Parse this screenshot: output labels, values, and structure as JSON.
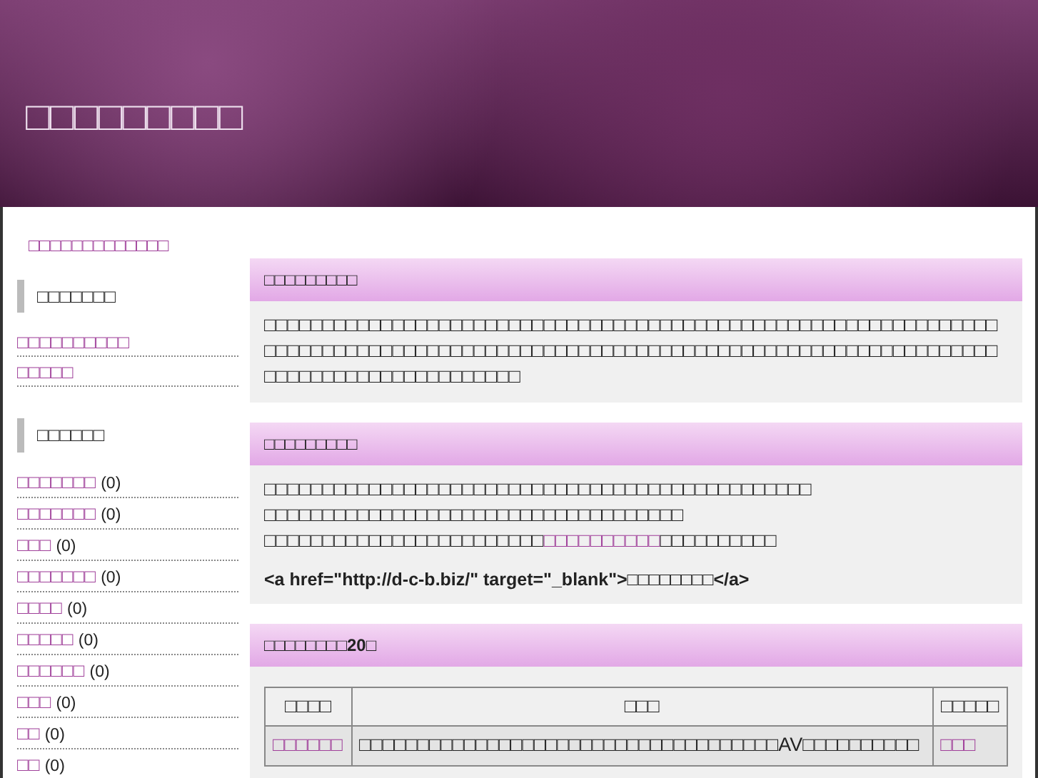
{
  "header": {
    "title": "□□□□□□□□□"
  },
  "breadcrumb": {
    "link": "□□□□□□□□□□□□□"
  },
  "sidebar": [
    {
      "heading": "□□□□□□□",
      "items": [
        {
          "label": "□□□□□□□□□□"
        },
        {
          "label": "□□□□□"
        }
      ]
    },
    {
      "heading": "□□□□□□",
      "items": [
        {
          "label": "□□□□□□□",
          "count": "(0)"
        },
        {
          "label": "□□□□□□□",
          "count": "(0)"
        },
        {
          "label": "□□□",
          "count": "(0)"
        },
        {
          "label": "□□□□□□□",
          "count": "(0)"
        },
        {
          "label": "□□□□",
          "count": "(0)"
        },
        {
          "label": "□□□□□",
          "count": "(0)"
        },
        {
          "label": "□□□□□□",
          "count": "(0)"
        },
        {
          "label": "□□□",
          "count": "(0)"
        },
        {
          "label": "□□",
          "count": "(0)"
        },
        {
          "label": "□□",
          "count": "(0)"
        }
      ]
    }
  ],
  "boxes": [
    {
      "kind": "text",
      "heading": "□□□□□□□□□",
      "paragraphs": [
        [
          {
            "kind": "text",
            "text": "□□□□□□□□□□□□□□□□□□□□□□□□□□□□□□□□□□□□□□□□□□□□□□□□□□□□□□□□□□□□□□□□□□□□□□□□□□□□□□□□□□□□□□□□□□□□□□□□□□□□□□□□□□□□□□□□□□□□□□□□□□□□□□□□□□□□□□□□□□□□□□□□□□□□"
          }
        ]
      ]
    },
    {
      "kind": "text",
      "heading": "□□□□□□□□□",
      "paragraphs": [
        [
          {
            "kind": "text",
            "text": "□□□□□□□□□□□□□□□□□□□□□□□□□□□□□□□□□□□□□□□□□□□□□□□"
          }
        ],
        [
          {
            "kind": "text",
            "text": "□□□□□□□□□□□□□□□□□□□□□□□□□□□□□□□□□□□□"
          }
        ],
        [
          {
            "kind": "text",
            "text": "□□□□□□□□□□□□□□□□□□□□□□□□"
          },
          {
            "kind": "link",
            "text": "□□□□□□□□□□"
          },
          {
            "kind": "text",
            "text": "□□□□□□□□□□"
          }
        ]
      ],
      "code": "<a href=\"http://d-c-b.biz/\" target=\"_blank\">□□□□□□□□</a>"
    },
    {
      "kind": "table",
      "heading": "□□□□□□□□20□",
      "table": {
        "columns": [
          "□□□□",
          "□□□",
          "□□□□□"
        ],
        "rows": [
          {
            "cells": [
              {
                "kind": "link",
                "text": "□□□□□□"
              },
              {
                "kind": "text",
                "text": "□□□□□□□□□□□□□□□□□□□□□□□□□□□□□□□□□□□□AV□□□□□□□□□□"
              },
              {
                "kind": "link",
                "text": "□□□"
              }
            ]
          }
        ]
      }
    }
  ]
}
